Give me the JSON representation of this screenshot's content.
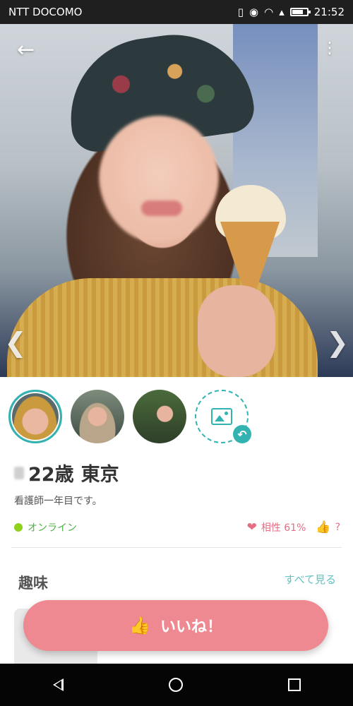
{
  "status_bar": {
    "carrier": "NTT DOCOMO",
    "time": "21:52",
    "icons": [
      "vibrate-icon",
      "eye-icon",
      "wifi-icon",
      "signal-icon",
      "battery-icon"
    ]
  },
  "header": {
    "back_icon": "arrow-left-icon",
    "menu_icon": "more-vertical-icon"
  },
  "photo": {
    "prev_icon": "chevron-left-icon",
    "next_icon": "chevron-right-icon"
  },
  "profile": {
    "age": "22歳",
    "location": "東京",
    "bio": "看護師一年目です。",
    "online_label": "オンライン",
    "compatibility_label": "相性 61%",
    "like_count": "?",
    "colors": {
      "accent_teal": "#32b3b1",
      "online_green": "#8fd11d",
      "pink": "#ef8991"
    }
  },
  "hobby": {
    "title": "趣味",
    "see_all": "すべて見る"
  },
  "like_button": {
    "label": "いいね！"
  }
}
